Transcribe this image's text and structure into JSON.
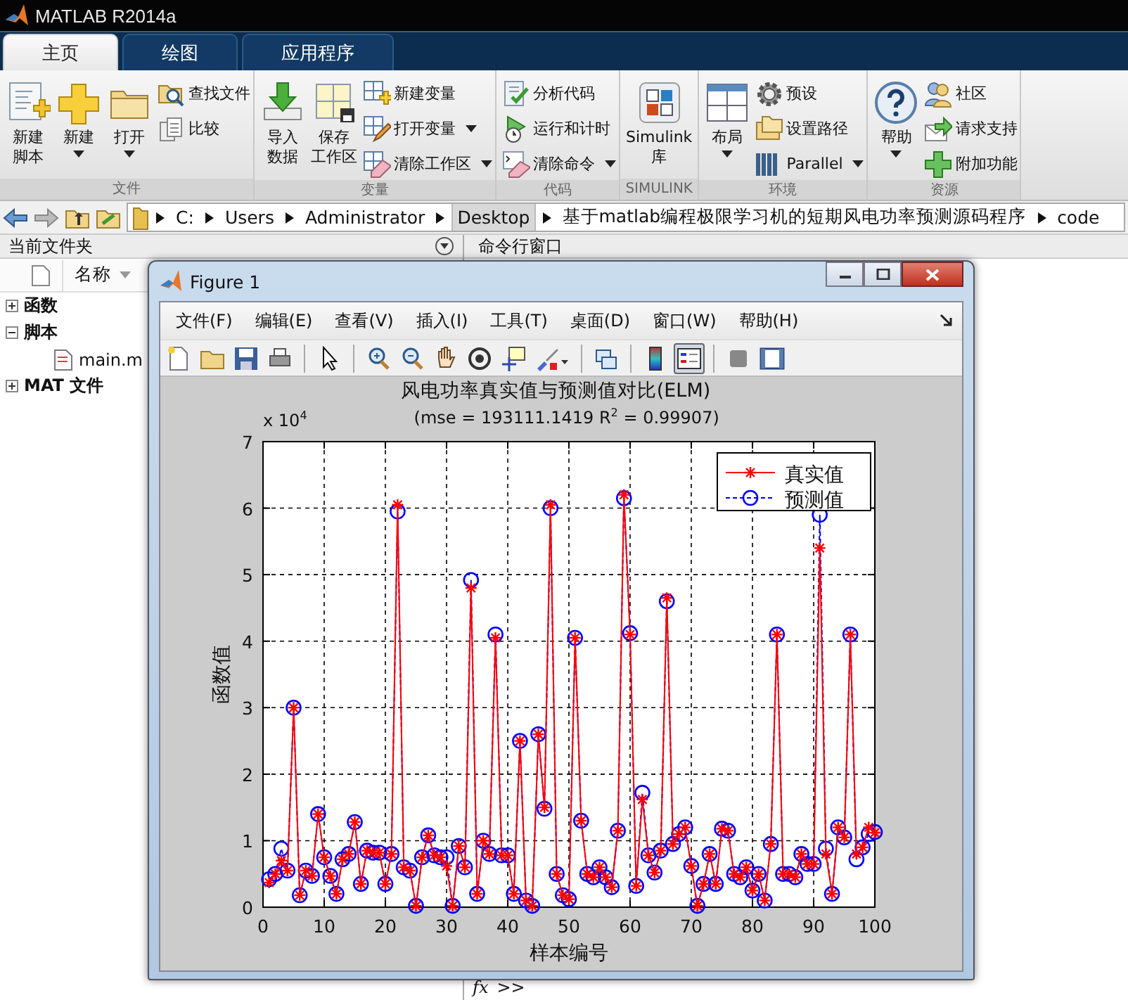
{
  "app": {
    "title": "MATLAB R2014a"
  },
  "ribbon_tabs": [
    {
      "label": "主页",
      "selected": true
    },
    {
      "label": "绘图",
      "selected": false
    },
    {
      "label": "应用程序",
      "selected": false
    }
  ],
  "toolstrip": [
    {
      "label": "文件",
      "columns": [
        {
          "kind": "large",
          "label": [
            "新建",
            "脚本"
          ],
          "menu": false
        },
        {
          "kind": "large",
          "label": [
            "新建"
          ],
          "menu": true
        },
        {
          "kind": "large",
          "label": [
            "打开"
          ],
          "menu": true
        },
        {
          "kind": "small",
          "items": [
            {
              "label": "查找文件",
              "menu": false
            },
            {
              "label": "比较",
              "menu": false
            }
          ]
        }
      ]
    },
    {
      "label": "变量",
      "columns": [
        {
          "kind": "large",
          "label": [
            "导入",
            "数据"
          ],
          "menu": false
        },
        {
          "kind": "large",
          "label": [
            "保存",
            "工作区"
          ],
          "menu": false
        },
        {
          "kind": "small",
          "items": [
            {
              "label": "新建变量",
              "menu": false
            },
            {
              "label": "打开变量",
              "menu": true
            },
            {
              "label": "清除工作区",
              "menu": true
            }
          ]
        }
      ]
    },
    {
      "label": "代码",
      "columns": [
        {
          "kind": "small",
          "items": [
            {
              "label": "分析代码",
              "menu": false
            },
            {
              "label": "运行和计时",
              "menu": false
            },
            {
              "label": "清除命令",
              "menu": true
            }
          ]
        }
      ]
    },
    {
      "label": "SIMULINK",
      "columns": [
        {
          "kind": "large",
          "label": [
            "Simulink",
            "库"
          ],
          "menu": false
        }
      ]
    },
    {
      "label": "环境",
      "columns": [
        {
          "kind": "large",
          "label": [
            "布局"
          ],
          "menu": true
        },
        {
          "kind": "small",
          "items": [
            {
              "label": "预设",
              "menu": false
            },
            {
              "label": "设置路径",
              "menu": false
            },
            {
              "label": "Parallel",
              "menu": true
            }
          ]
        }
      ]
    },
    {
      "label": "资源",
      "columns": [
        {
          "kind": "large",
          "label": [
            "帮助"
          ],
          "menu": true
        },
        {
          "kind": "small",
          "items": [
            {
              "label": "社区",
              "menu": false
            },
            {
              "label": "请求支持",
              "menu": false
            },
            {
              "label": "附加功能",
              "menu": false
            }
          ]
        }
      ]
    }
  ],
  "path_bar": {
    "crumbs": [
      {
        "label": "C:",
        "highlighted": false
      },
      {
        "label": "Users",
        "highlighted": false
      },
      {
        "label": "Administrator",
        "highlighted": false
      },
      {
        "label": "Desktop",
        "highlighted": true
      },
      {
        "label": "基于matlab编程极限学习机的短期风电功率预测源码程序",
        "highlighted": false
      },
      {
        "label": "code",
        "highlighted": false
      }
    ]
  },
  "current_folder": {
    "title": "当前文件夹",
    "column": "名称",
    "tree": [
      {
        "label": "函数",
        "expanded": false
      },
      {
        "label": "脚本",
        "expanded": true,
        "children": [
          {
            "label": "main.m"
          }
        ]
      },
      {
        "label": "MAT 文件",
        "expanded": false
      }
    ]
  },
  "command_window": {
    "title": "命令行窗口",
    "function_button": "fx",
    "prompt": ">>"
  },
  "figure": {
    "title": "Figure 1",
    "menu": [
      "文件(F)",
      "编辑(E)",
      "查看(V)",
      "插入(I)",
      "工具(T)",
      "桌面(D)",
      "窗口(W)",
      "帮助(H)"
    ],
    "toolbar": [
      {
        "selected": false
      },
      {
        "selected": false
      },
      {
        "selected": false
      },
      {
        "selected": false
      },
      {
        "selected": false
      },
      {
        "selected": false
      },
      {
        "selected": false
      },
      {
        "selected": false
      },
      {
        "selected": false
      },
      {
        "selected": false
      },
      {
        "selected": false
      },
      {
        "selected": false
      },
      {
        "selected": false
      },
      {
        "selected": true
      },
      {
        "selected": false
      },
      {
        "selected": false
      }
    ],
    "subtitle": "(mse = 193111.1419 R$^{2}$ = 0.99907)",
    "y_multiplier": "x 10$^{4}$",
    "chart_data": {
      "type": "line",
      "title": "风电功率真实值与预测值对比(ELM)",
      "xlabel": "样本编号",
      "ylabel": "函数值",
      "xlim": [
        0,
        100
      ],
      "ylim": [
        0,
        7
      ],
      "xticks": [
        0,
        10,
        20,
        30,
        40,
        50,
        60,
        70,
        80,
        90,
        100
      ],
      "yticks": [
        0,
        1,
        2,
        3,
        4,
        5,
        6,
        7
      ],
      "grid": true,
      "legend": true,
      "x": [
        1,
        2,
        3,
        4,
        5,
        6,
        7,
        8,
        9,
        10,
        11,
        12,
        13,
        14,
        15,
        16,
        17,
        18,
        19,
        20,
        21,
        22,
        23,
        24,
        25,
        26,
        27,
        28,
        29,
        30,
        31,
        32,
        33,
        34,
        35,
        36,
        37,
        38,
        39,
        40,
        41,
        42,
        43,
        44,
        45,
        46,
        47,
        48,
        49,
        50,
        51,
        52,
        53,
        54,
        55,
        56,
        57,
        58,
        59,
        60,
        61,
        62,
        63,
        64,
        65,
        66,
        67,
        68,
        69,
        70,
        71,
        72,
        73,
        74,
        75,
        76,
        77,
        78,
        79,
        80,
        81,
        82,
        83,
        84,
        85,
        86,
        87,
        88,
        89,
        90,
        91,
        92,
        93,
        94,
        95,
        96,
        97,
        98,
        99,
        100
      ],
      "series": [
        {
          "name": "真实值",
          "color": "#ff0000",
          "marker": "cross",
          "line_style": "solid",
          "values": [
            0.37,
            0.5,
            0.7,
            0.55,
            3.0,
            0.18,
            0.55,
            0.47,
            1.4,
            0.75,
            0.47,
            0.2,
            0.72,
            0.8,
            1.28,
            0.35,
            0.85,
            0.82,
            0.82,
            0.35,
            0.8,
            6.05,
            0.6,
            0.55,
            0.02,
            0.75,
            1.08,
            0.78,
            0.75,
            0.62,
            0.02,
            0.92,
            0.6,
            4.8,
            0.2,
            1.0,
            0.8,
            4.05,
            0.78,
            0.78,
            0.2,
            2.5,
            0.1,
            0.02,
            2.6,
            1.5,
            6.05,
            0.5,
            0.18,
            0.12,
            4.05,
            1.3,
            0.5,
            0.45,
            0.6,
            0.45,
            0.3,
            1.15,
            6.2,
            4.1,
            0.32,
            1.62,
            0.78,
            0.52,
            0.85,
            4.65,
            0.95,
            1.1,
            1.2,
            0.62,
            0.02,
            0.35,
            0.8,
            0.35,
            1.18,
            1.15,
            0.5,
            0.45,
            0.6,
            0.25,
            0.5,
            0.1,
            0.95,
            4.1,
            0.5,
            0.5,
            0.45,
            0.8,
            0.65,
            0.65,
            5.4,
            0.8,
            0.2,
            1.2,
            1.05,
            4.1,
            0.8,
            0.9,
            1.2,
            1.12
          ]
        },
        {
          "name": "预测值",
          "color": "#0000ff",
          "marker": "circle",
          "line_style": "dashed",
          "values": [
            0.42,
            0.5,
            0.88,
            0.55,
            3.0,
            0.18,
            0.55,
            0.47,
            1.4,
            0.75,
            0.47,
            0.2,
            0.72,
            0.8,
            1.28,
            0.35,
            0.85,
            0.82,
            0.82,
            0.35,
            0.8,
            5.95,
            0.6,
            0.55,
            0.02,
            0.75,
            1.08,
            0.78,
            0.75,
            0.75,
            0.02,
            0.92,
            0.6,
            4.92,
            0.2,
            1.0,
            0.8,
            4.1,
            0.78,
            0.78,
            0.2,
            2.5,
            0.1,
            0.02,
            2.6,
            1.48,
            6.0,
            0.5,
            0.18,
            0.12,
            4.05,
            1.3,
            0.5,
            0.45,
            0.6,
            0.45,
            0.3,
            1.15,
            6.15,
            4.12,
            0.32,
            1.72,
            0.78,
            0.52,
            0.85,
            4.6,
            0.95,
            1.1,
            1.2,
            0.62,
            0.02,
            0.35,
            0.8,
            0.35,
            1.18,
            1.15,
            0.5,
            0.45,
            0.6,
            0.25,
            0.5,
            0.1,
            0.95,
            4.1,
            0.5,
            0.5,
            0.45,
            0.8,
            0.65,
            0.65,
            5.9,
            0.88,
            0.2,
            1.2,
            1.05,
            4.1,
            0.72,
            0.9,
            1.1,
            1.13
          ]
        }
      ]
    }
  }
}
